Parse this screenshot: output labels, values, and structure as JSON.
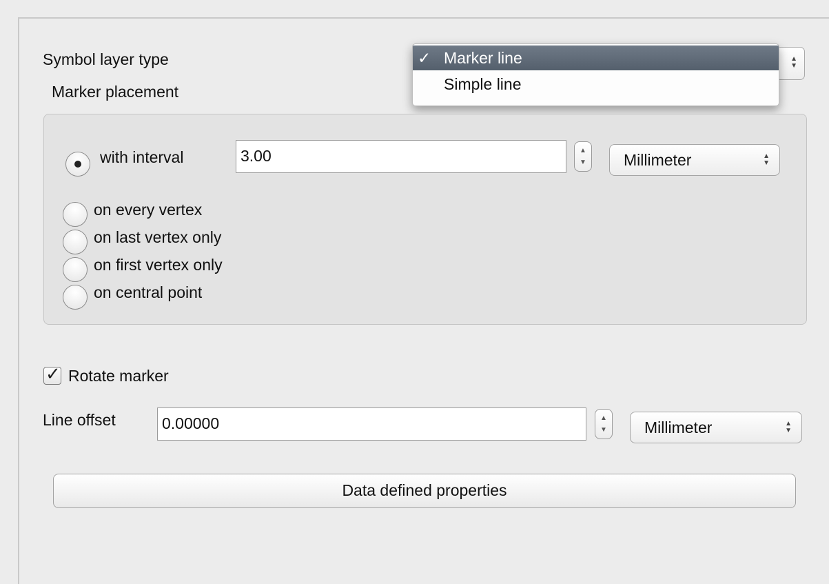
{
  "symbol_layer": {
    "label": "Symbol layer type",
    "options": [
      "Marker line",
      "Simple line"
    ],
    "selected_index": 0,
    "check_mark": "✓"
  },
  "marker_placement": {
    "title": "Marker placement",
    "interval_label": "with interval",
    "interval_value": "3.00",
    "interval_unit": "Millimeter",
    "selected_option": "with interval",
    "options": [
      "on every vertex",
      "on last vertex only",
      "on first vertex only",
      "on central point"
    ]
  },
  "rotate_marker": {
    "label": "Rotate marker",
    "checked": true
  },
  "line_offset": {
    "label": "Line offset",
    "value": "0.00000",
    "unit": "Millimeter"
  },
  "data_defined_button": "Data defined properties",
  "icons": {
    "spin": "up-down-spinner-icon",
    "combo": "combo-arrows-icon",
    "check": "checkmark-icon"
  },
  "colors": {
    "selection": "#5f6a77",
    "background": "#ececec",
    "group_bg": "#e3e3e3"
  }
}
